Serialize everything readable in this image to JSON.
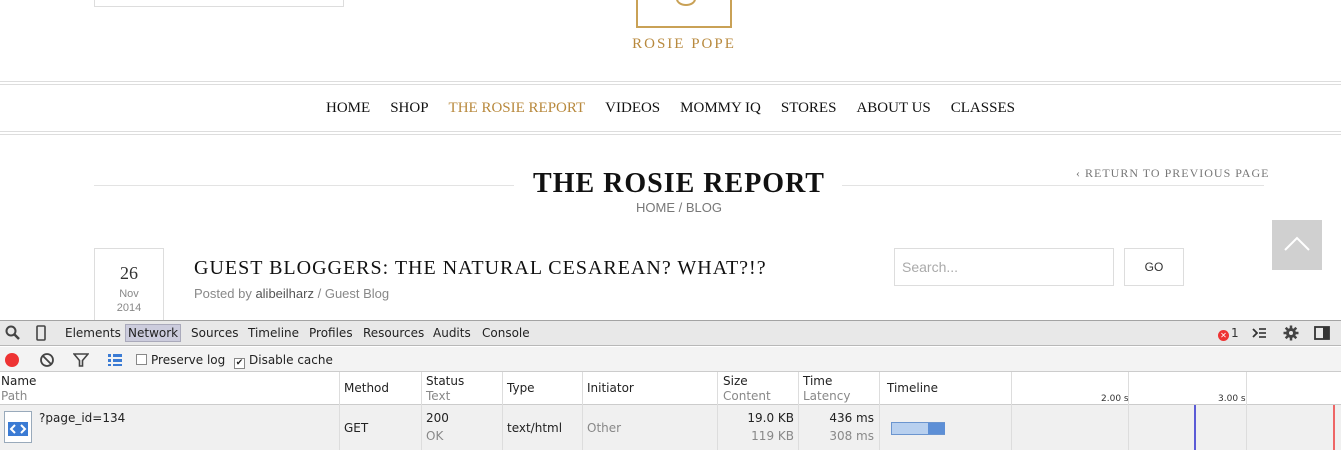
{
  "site": {
    "brand": "ROSIE POPE",
    "nav": [
      "HOME",
      "SHOP",
      "THE ROSIE REPORT",
      "VIDEOS",
      "MOMMY IQ",
      "STORES",
      "ABOUT US",
      "CLASSES"
    ],
    "active_nav": "THE ROSIE REPORT",
    "page_title": "THE ROSIE REPORT",
    "breadcrumb": {
      "home": "HOME",
      "sep": " / ",
      "current": "BLOG"
    },
    "return_link": "RETURN TO PREVIOUS PAGE",
    "post": {
      "day": "26",
      "month": "Nov",
      "year": "2014",
      "title": "GUEST BLOGGERS: THE NATURAL CESAREAN? WHAT?!?",
      "meta_prefix": "Posted by ",
      "author": "alibeilharz",
      "meta_sep": " / ",
      "category": "Guest Blog"
    },
    "search": {
      "placeholder": "Search...",
      "button": "GO"
    },
    "colors": {
      "accent": "#b8893d"
    }
  },
  "devtools": {
    "tabs": [
      "Elements",
      "Network",
      "Sources",
      "Timeline",
      "Profiles",
      "Resources",
      "Audits",
      "Console"
    ],
    "selected_tab": "Network",
    "error_count": "1",
    "toolbar": {
      "preserve_log": "Preserve log",
      "preserve_log_checked": false,
      "disable_cache": "Disable cache",
      "disable_cache_checked": true
    },
    "headers": {
      "name": "Name",
      "path": "Path",
      "method": "Method",
      "status": "Status",
      "text": "Text",
      "type": "Type",
      "initiator": "Initiator",
      "size": "Size",
      "content": "Content",
      "time": "Time",
      "latency": "Latency",
      "timeline": "Timeline"
    },
    "ticks": [
      "2.00 s",
      "3.00 s"
    ],
    "rows": [
      {
        "name": "?page_id=134",
        "method": "GET",
        "status": "200",
        "status_text": "OK",
        "type": "text/html",
        "initiator": "Other",
        "size": "19.0 KB",
        "content": "119 KB",
        "time": "436 ms",
        "latency": "308 ms"
      }
    ]
  }
}
